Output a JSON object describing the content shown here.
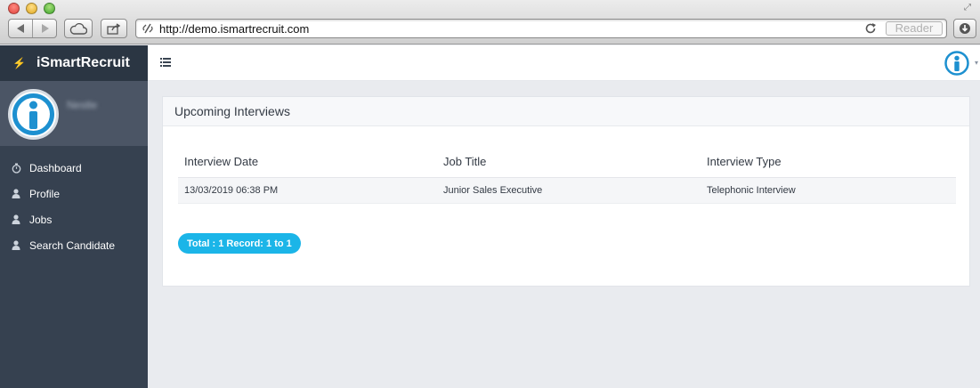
{
  "browser": {
    "url": "http://demo.ismartrecruit.com",
    "reader_label": "Reader"
  },
  "sidebar": {
    "brand": "iSmartRecruit",
    "company_name": "Nestle",
    "items": [
      {
        "label": "Dashboard",
        "icon": "stopwatch-icon"
      },
      {
        "label": "Profile",
        "icon": "user-icon"
      },
      {
        "label": "Jobs",
        "icon": "user-icon"
      },
      {
        "label": "Search Candidate",
        "icon": "user-icon"
      }
    ]
  },
  "panel": {
    "title": "Upcoming Interviews",
    "columns": [
      "Interview Date",
      "Job Title",
      "Interview Type"
    ],
    "rows": [
      [
        "13/03/2019 06:38 PM",
        "Junior Sales Executive",
        "Telephonic Interview"
      ]
    ],
    "total_label": "Total : 1 Record: 1 to 1"
  },
  "colors": {
    "sidebar_bg": "#364150",
    "brand_bg": "#2b3643",
    "accent": "#1bb5e8",
    "page_bg": "#e9ebef"
  }
}
